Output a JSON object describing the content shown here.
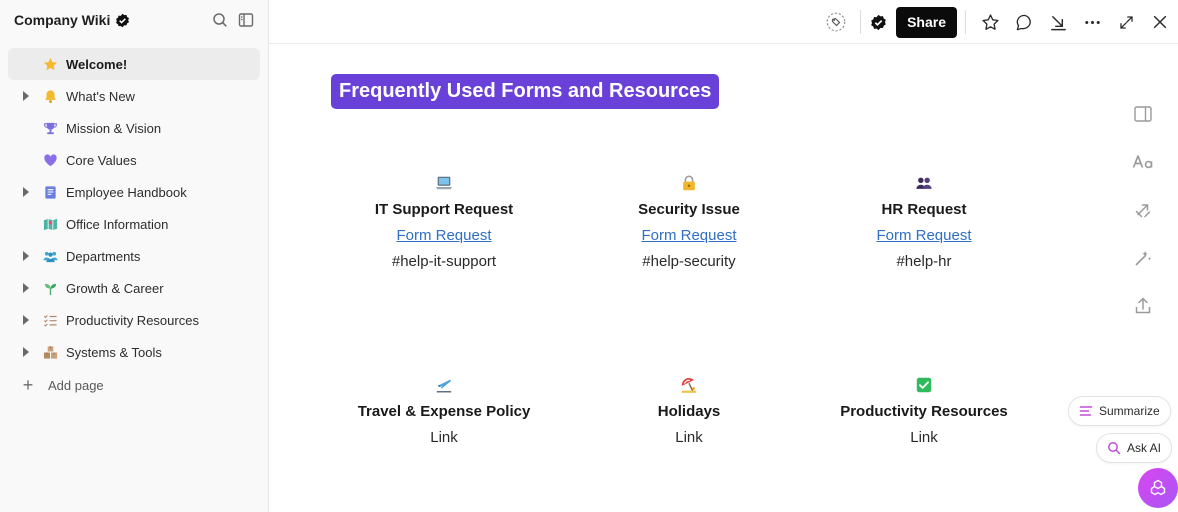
{
  "sidebar": {
    "title": "Company Wiki",
    "items": [
      {
        "label": "Welcome!",
        "icon": "star-icon",
        "active": true
      },
      {
        "label": "What's New",
        "icon": "bell-icon",
        "caret": true
      },
      {
        "label": "Mission & Vision",
        "icon": "trophy-icon"
      },
      {
        "label": "Core Values",
        "icon": "heart-icon"
      },
      {
        "label": "Employee Handbook",
        "icon": "book-icon",
        "caret": true
      },
      {
        "label": "Office Information",
        "icon": "map-icon"
      },
      {
        "label": "Departments",
        "icon": "people-icon",
        "caret": true
      },
      {
        "label": "Growth & Career",
        "icon": "seedling-icon",
        "caret": true
      },
      {
        "label": "Productivity Resources",
        "icon": "checklist-icon",
        "caret": true
      },
      {
        "label": "Systems & Tools",
        "icon": "boxes-icon",
        "caret": true
      }
    ],
    "add_page": "Add page"
  },
  "topbar": {
    "share_label": "Share"
  },
  "main": {
    "heading": "Frequently Used Forms and Resources",
    "cards": [
      {
        "icon": "laptop-icon",
        "title": "IT Support Request",
        "link": "Form Request",
        "channel": "#help-it-support"
      },
      {
        "icon": "lock-icon",
        "title": "Security Issue",
        "link": "Form Request",
        "channel": "#help-security"
      },
      {
        "icon": "people-icon",
        "title": "HR Request",
        "link": "Form Request",
        "channel": "#help-hr"
      },
      {
        "icon": "airplane-icon",
        "title": "Travel & Expense Policy",
        "link": "Link"
      },
      {
        "icon": "beach-umbrella-icon",
        "title": "Holidays",
        "link": "Link"
      },
      {
        "icon": "check-box-icon",
        "title": "Productivity Resources",
        "link": "Link"
      }
    ]
  },
  "floating": {
    "summarize": "Summarize",
    "ask_ai": "Ask AI"
  },
  "colors": {
    "accent": "#6941d8",
    "link": "#2f6fc4",
    "share_bg": "#0b0b0b",
    "ai_gradient_start": "#d946ef",
    "ai_gradient_end": "#a855f7"
  }
}
